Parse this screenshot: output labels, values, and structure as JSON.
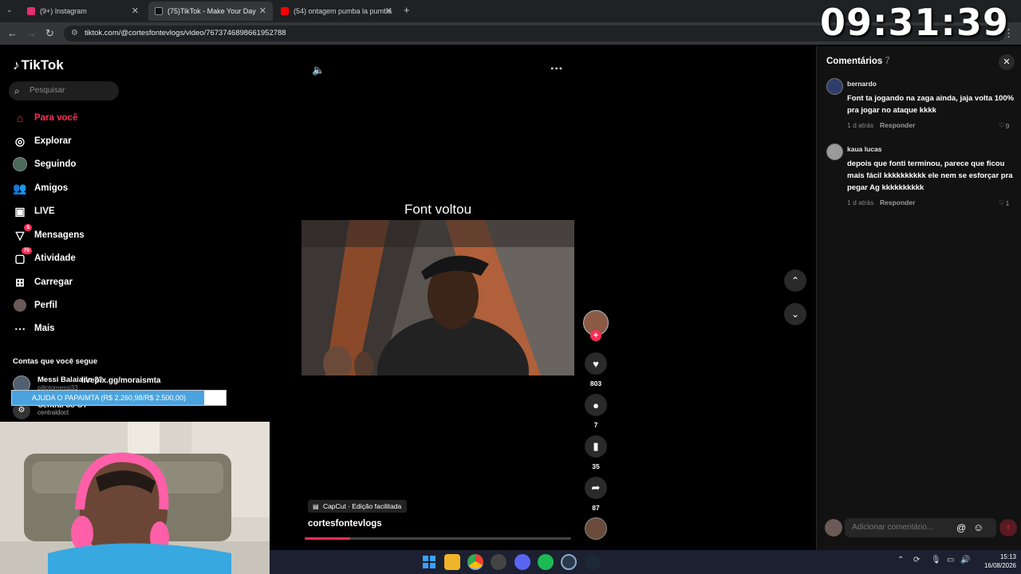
{
  "clock": "09:31:39",
  "browser": {
    "tabs": [
      {
        "label": "(9+) Instagram",
        "color": "#e1306c"
      },
      {
        "label": "(75)TikTok - Make Your Day",
        "color": "#000000"
      },
      {
        "label": "(54) ontagem pumba la pumba",
        "color": "#ff0000"
      }
    ],
    "url": "tiktok.com/@cortesfontevlogs/video/7673746898661952788"
  },
  "sidebar": {
    "logo": "TikTok",
    "search_placeholder": "Pesquisar",
    "items": [
      {
        "label": "Para você",
        "icon": "home-icon",
        "active": true
      },
      {
        "label": "Explorar",
        "icon": "compass-icon"
      },
      {
        "label": "Seguindo",
        "icon": "following-avatar-icon"
      },
      {
        "label": "Amigos",
        "icon": "friends-icon"
      },
      {
        "label": "LIVE",
        "icon": "live-tv-icon"
      },
      {
        "label": "Mensagens",
        "icon": "message-icon",
        "badge": "5"
      },
      {
        "label": "Atividade",
        "icon": "activity-icon",
        "badge": "70"
      },
      {
        "label": "Carregar",
        "icon": "upload-plus-icon"
      },
      {
        "label": "Perfil",
        "icon": "profile-avatar-icon"
      },
      {
        "label": "Mais",
        "icon": "more-dots-icon"
      }
    ],
    "following_title": "Contas que você segue",
    "following": [
      {
        "name": "Messi Balaiado 33",
        "handle": "pillotomessi33"
      },
      {
        "name": "Central do CT",
        "handle": "centraldoct"
      }
    ]
  },
  "donation": {
    "link": "livepix.gg/moraismta",
    "text": "AJUDA O PAPAIMTA (R$ 2.260,98/R$ 2.500,00)",
    "progress": 0.9
  },
  "video": {
    "title": "Font voltou",
    "badge": "CapCut · Edição facilitada",
    "author": "cortesfontevlogs",
    "progress": 0.17
  },
  "actions": {
    "likes": "803",
    "comments": "7",
    "saves": "35",
    "shares": "87"
  },
  "comments": {
    "title": "Comentários",
    "count": "7",
    "items": [
      {
        "user": "bernardo",
        "text": "Font ta jogando na zaga ainda, jaja volta 100% pra jogar no ataque kkkk",
        "time": "1 d atrás",
        "reply": "Responder",
        "likes": "9"
      },
      {
        "user": "kaua lucas",
        "text": "depois que fonti terminou, parece que ficou maís fácil kkkkkkkkkk ele nem se esforçar pra pegar Ag kkkkkkkkkk",
        "time": "1 d atrás",
        "reply": "Responder",
        "likes": "1"
      }
    ],
    "input_placeholder": "Adicionar comentário..."
  },
  "taskbar": {
    "time": "15:13",
    "date": "16/08/2026"
  }
}
